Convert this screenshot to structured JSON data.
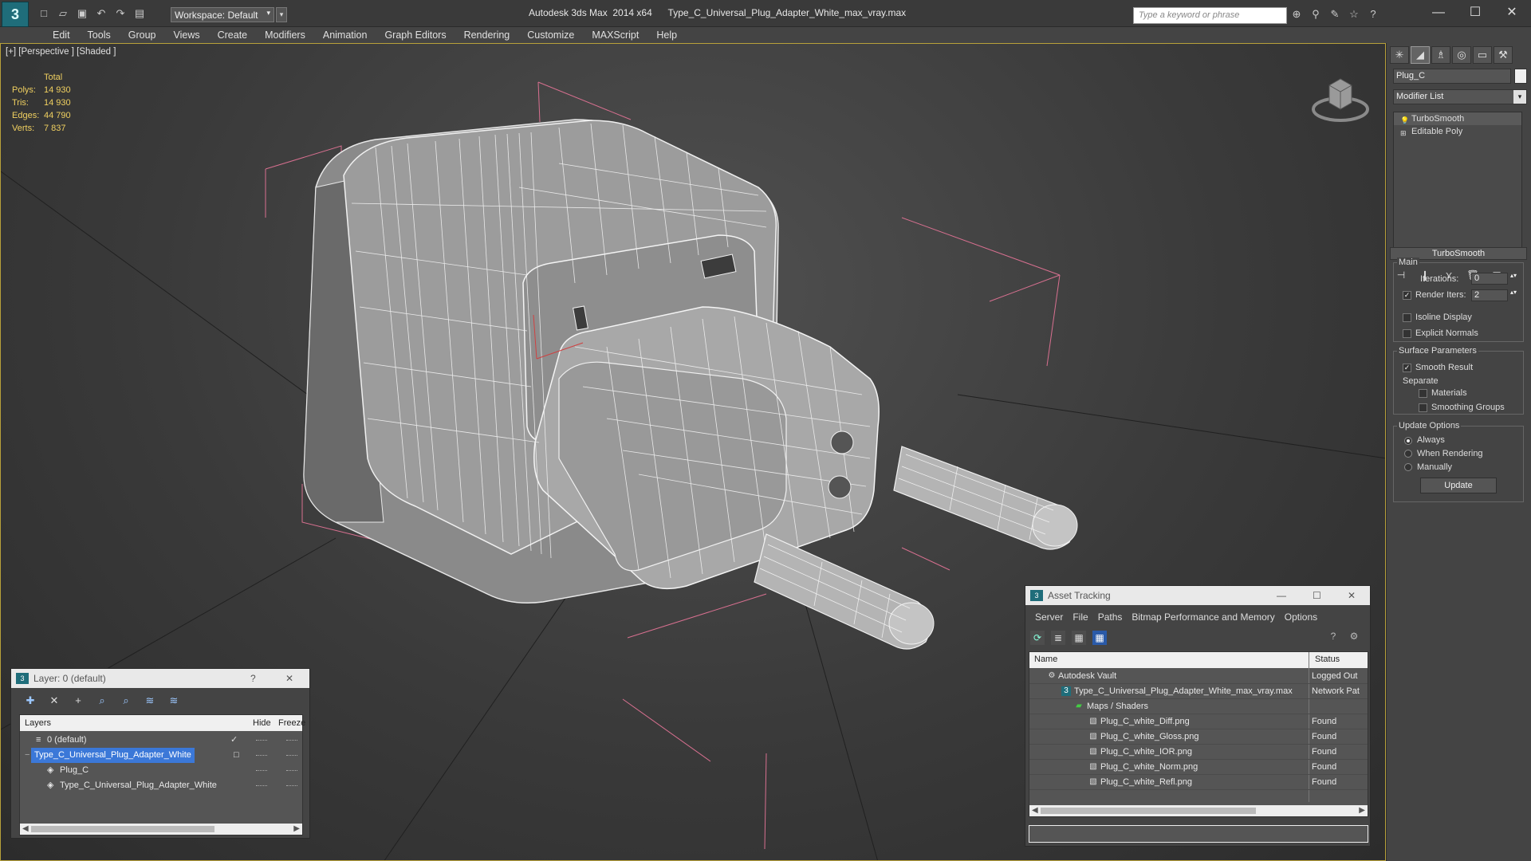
{
  "title_bar": {
    "app_logo": "3",
    "workspace": "Workspace: Default",
    "title": "Autodesk 3ds Max  2014 x64      Type_C_Universal_Plug_Adapter_White_max_vray.max",
    "search_placeholder": "Type a keyword or phrase",
    "minimize": "—",
    "maximize": "☐",
    "close": "✕"
  },
  "menu": [
    "Edit",
    "Tools",
    "Group",
    "Views",
    "Create",
    "Modifiers",
    "Animation",
    "Graph Editors",
    "Rendering",
    "Customize",
    "MAXScript",
    "Help"
  ],
  "viewport": {
    "label": "[+] [Perspective ] [Shaded ]",
    "stats_header": "Total",
    "stats": [
      {
        "k": "Polys:",
        "v": "14 930"
      },
      {
        "k": "Tris:",
        "v": "14 930"
      },
      {
        "k": "Edges:",
        "v": "44 790"
      },
      {
        "k": "Verts:",
        "v": "7 837"
      }
    ]
  },
  "command_panel": {
    "object_name": "Plug_C",
    "modifier_list": "Modifier List",
    "stack": [
      "TurboSmooth",
      "Editable Poly"
    ],
    "rollout": "TurboSmooth",
    "main_group": "Main",
    "iterations_label": "Iterations:",
    "iterations": "0",
    "render_iters_label": "Render Iters:",
    "render_iters": "2",
    "isoline": "Isoline Display",
    "explicit_normals": "Explicit Normals",
    "surface_group": "Surface Parameters",
    "smooth_result": "Smooth Result",
    "separate": "Separate",
    "materials": "Materials",
    "smoothing_groups": "Smoothing Groups",
    "update_group": "Update Options",
    "always": "Always",
    "when_rendering": "When Rendering",
    "manually": "Manually",
    "update_button": "Update"
  },
  "layer_dialog": {
    "title": "Layer: 0 (default)",
    "help": "?",
    "close": "✕",
    "col_layers": "Layers",
    "col_hide": "Hide",
    "col_freeze": "Freeze",
    "rows": [
      {
        "name": "0 (default)"
      },
      {
        "name": "Type_C_Universal_Plug_Adapter_White"
      },
      {
        "name": "Plug_C"
      },
      {
        "name": "Type_C_Universal_Plug_Adapter_White"
      }
    ]
  },
  "asset_dialog": {
    "title": "Asset Tracking",
    "minimize": "—",
    "maximize": "☐",
    "close": "✕",
    "menu": [
      "Server",
      "File",
      "Paths",
      "Bitmap Performance and Memory",
      "Options"
    ],
    "col_name": "Name",
    "col_status": "Status",
    "rows": [
      {
        "name": "Autodesk Vault",
        "status": "Logged Out"
      },
      {
        "name": "Type_C_Universal_Plug_Adapter_White_max_vray.max",
        "status": "Network Pat"
      },
      {
        "name": "Maps / Shaders",
        "status": ""
      },
      {
        "name": "Plug_C_white_Diff.png",
        "status": "Found"
      },
      {
        "name": "Plug_C_white_Gloss.png",
        "status": "Found"
      },
      {
        "name": "Plug_C_white_IOR.png",
        "status": "Found"
      },
      {
        "name": "Plug_C_white_Norm.png",
        "status": "Found"
      },
      {
        "name": "Plug_C_white_Refl.png",
        "status": "Found"
      }
    ]
  }
}
